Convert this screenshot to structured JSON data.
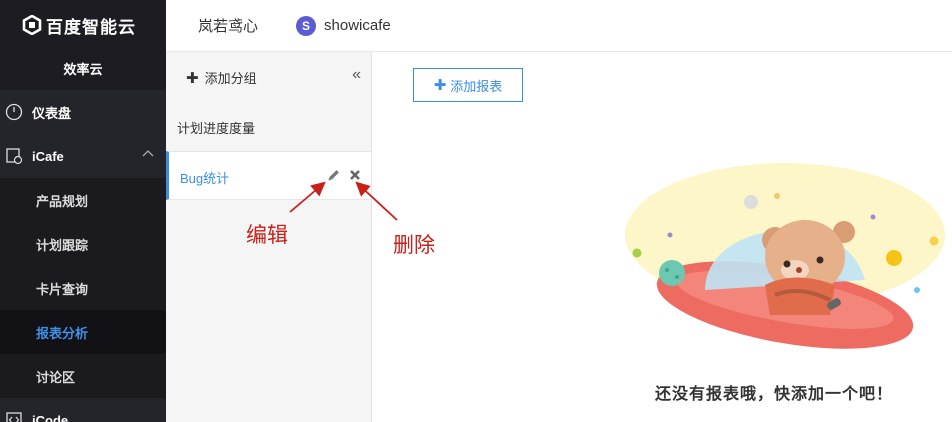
{
  "brand": {
    "name": "百度智能云",
    "product": "效率云"
  },
  "nav": {
    "dashboard": "仪表盘",
    "icafe": "iCafe",
    "sub_items": [
      "产品规划",
      "计划跟踪",
      "卡片查询",
      "报表分析",
      "讨论区"
    ],
    "icode": "iCode"
  },
  "topbar": {
    "org": "岚若鸢心",
    "space_initial": "S",
    "space_name": "showicafe"
  },
  "groups": {
    "add_label": "添加分组",
    "collapse_glyph": "«",
    "group_name": "计划进度度量",
    "report_name": "Bug统计"
  },
  "annotations": {
    "edit": "编辑",
    "delete": "删除"
  },
  "main": {
    "add_report_label": "添加报表",
    "empty_message": "还没有报表哦，快添加一个吧！"
  },
  "colors": {
    "accent": "#3a8ee6",
    "annotation_red": "#c8201a",
    "sidebar_bg": "#1c1c22"
  }
}
